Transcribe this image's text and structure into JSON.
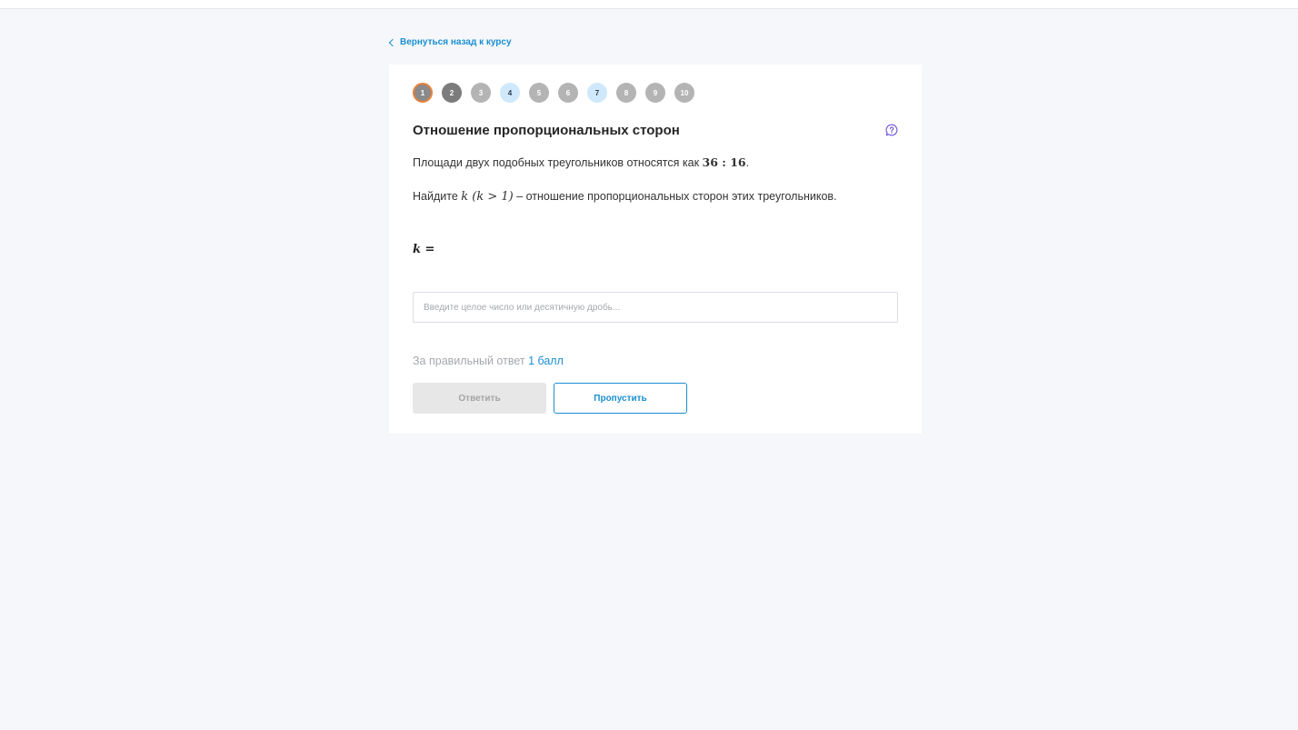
{
  "nav": {
    "back_label": "Вернуться назад к курсу"
  },
  "steps": [
    "1",
    "2",
    "3",
    "4",
    "5",
    "6",
    "7",
    "8",
    "9",
    "10"
  ],
  "task": {
    "title": "Отношение пропорциональных сторон",
    "p1_text": "Площади двух подобных треугольников относятся как ",
    "p1_math": "36 : 16",
    "p1_end": ".",
    "p2_text": "Найдите ",
    "p2_math": "k  (k > 1)",
    "p2_rest": " – отношение пропорциональных сторон этих треугольников.",
    "answer_label": "k ="
  },
  "input": {
    "placeholder": "Введите целое число или десятичную дробь..."
  },
  "score": {
    "prefix": "За правильный ответ ",
    "points": "1 балл"
  },
  "buttons": {
    "answer_label": "Ответить",
    "skip_label": "Пропустить"
  },
  "colors": {
    "accent": "#1a8fd1",
    "current_step_ring": "#e8823a",
    "help_icon": "#6b4fd8"
  },
  "icons": {
    "back": "chevron-left-icon",
    "help": "question-bubble-icon"
  }
}
